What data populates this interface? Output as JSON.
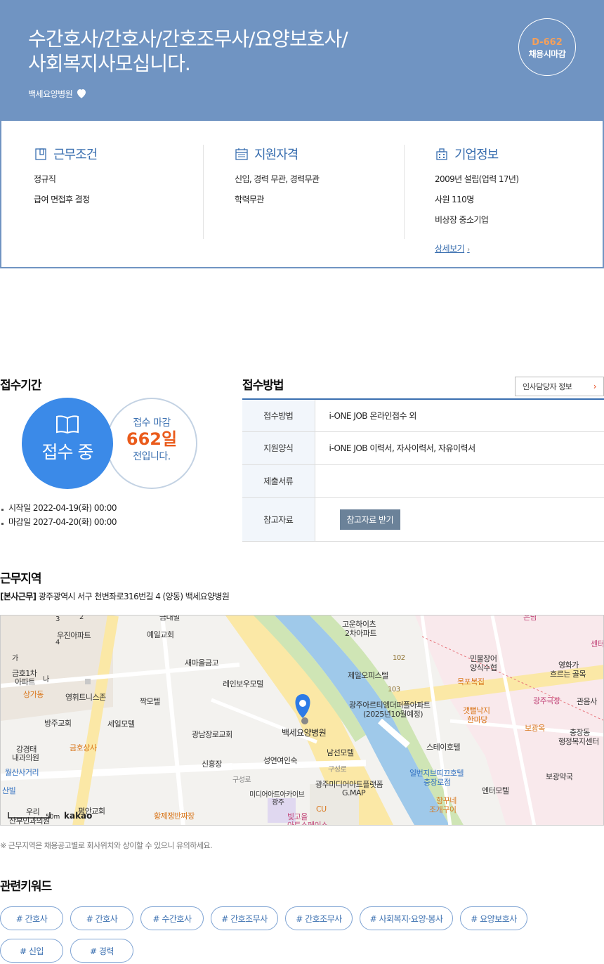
{
  "header": {
    "title_line1": "수간호사/간호사/간호조무사/요양보호사/",
    "title_line2": "사회복지사모십니다.",
    "company": "백세요양병원",
    "dday": "D-662",
    "dday_status": "채용시마감",
    "heart_icon": "heart-icon"
  },
  "conditions": {
    "work": {
      "title": "근무조건",
      "lines": [
        "정규직",
        "급여 면접후 결정"
      ]
    },
    "qualification": {
      "title": "지원자격",
      "lines": [
        "신입, 경력 무관, 경력무관",
        "학력무관"
      ]
    },
    "company_info": {
      "title": "기업정보",
      "lines": [
        "2009년 설립(업력 17년)",
        "사원 110명",
        "비상장 중소기업"
      ],
      "more": "상세보기"
    }
  },
  "reception_period": {
    "title": "접수기간",
    "status": "접수 중",
    "deadline_label": "접수 마감",
    "days": "662일",
    "deadline_suffix": "전입니다.",
    "start": "시작일 2022-04-19(화) 00:00",
    "end": "마감일 2027-04-20(화) 00:00"
  },
  "reception_method": {
    "title": "접수방법",
    "hr_button": "인사담당자 정보",
    "rows": [
      {
        "label": "접수방법",
        "value": "i-ONE JOB 온라인접수 외"
      },
      {
        "label": "지원양식",
        "value": "i-ONE JOB 이력서, 자사이력서, 자유이력서"
      },
      {
        "label": "제출서류",
        "value": ""
      },
      {
        "label": "참고자료",
        "button": "참고자료 받기"
      }
    ]
  },
  "work_region": {
    "title": "근무지역",
    "address_tag": "[본사근무]",
    "address": " 광주광역시 서구 천변좌로316번길 4 (양동) 백세요양병원",
    "notice": "※ 근무지역은 채용공고별로 회사위치와 상이할 수 있으니 유의하세요.",
    "map": {
      "scale": "50m",
      "brand": "kakao",
      "labels": {
        "l1": "우진아파트",
        "l2": "예일교회",
        "l3": "새마을금고",
        "l4": "레인보우모텔",
        "l5": "금호1차",
        "l6": "아파트",
        "l7": "상가동",
        "l8": "영휘트니스존",
        "l9": "짝모텔",
        "l10": "방주교회",
        "l11": "세일모텔",
        "l12": "금호상사",
        "l13": "강경태",
        "l14": "내과의원",
        "l15": "월산사거리",
        "l16": "광남장로교회",
        "l17": "신흥장",
        "l18": "성연여인숙",
        "l19": "백세요양병원",
        "l20": "남선모텔",
        "l21": "구성로",
        "l22": "구성로",
        "l23": "광주미디어아트플랫폼",
        "l24": "G.MAP",
        "l25": "미디어아트아카이브",
        "l26": "광주",
        "l27": "CU",
        "l28": "빛고을",
        "l29": "아트스페이스",
        "l30": "황제쟁반짜장",
        "l31": "평안교회",
        "l32": "우리",
        "l33": "산부인과의원",
        "l34": "고운하이츠",
        "l35": "2차아파트",
        "l36": "제일오피스텔",
        "l37": "102",
        "l38": "103",
        "l39": "광주아르티엠더퍼플아파트",
        "l40": "(2025년10월예정)",
        "l41": "목포복집",
        "l42": "갯뻘낙지",
        "l43": "한마당",
        "l44": "민물장어",
        "l45": "양식수협",
        "l46": "스테이호텔",
        "l47": "일번지브띠끄호텔",
        "l48": "충장로점",
        "l49": "엔터모텔",
        "l50": "항꾸네",
        "l51": "조개구이",
        "l52": "영화가",
        "l53": "흐르는 골목",
        "l54": "광주극장",
        "l55": "관음사",
        "l56": "보광옥",
        "l57": "충장동",
        "l58": "행정복지센터",
        "l59": "보광약국",
        "l60": "센터",
        "l61": "산빌",
        "l62": "가",
        "l63": "나",
        "l64": "3",
        "l65": "4",
        "l66": "2",
        "l67": "금대빌",
        "l68": "은남"
      }
    }
  },
  "keywords": {
    "title": "관련키워드",
    "items": [
      "# 간호사",
      "# 간호사",
      "# 수간호사",
      "# 간호조무사",
      "# 간호조무사",
      "# 사회복지·요양·봉사",
      "# 요양보호사",
      "# 신입",
      "# 경력"
    ]
  }
}
